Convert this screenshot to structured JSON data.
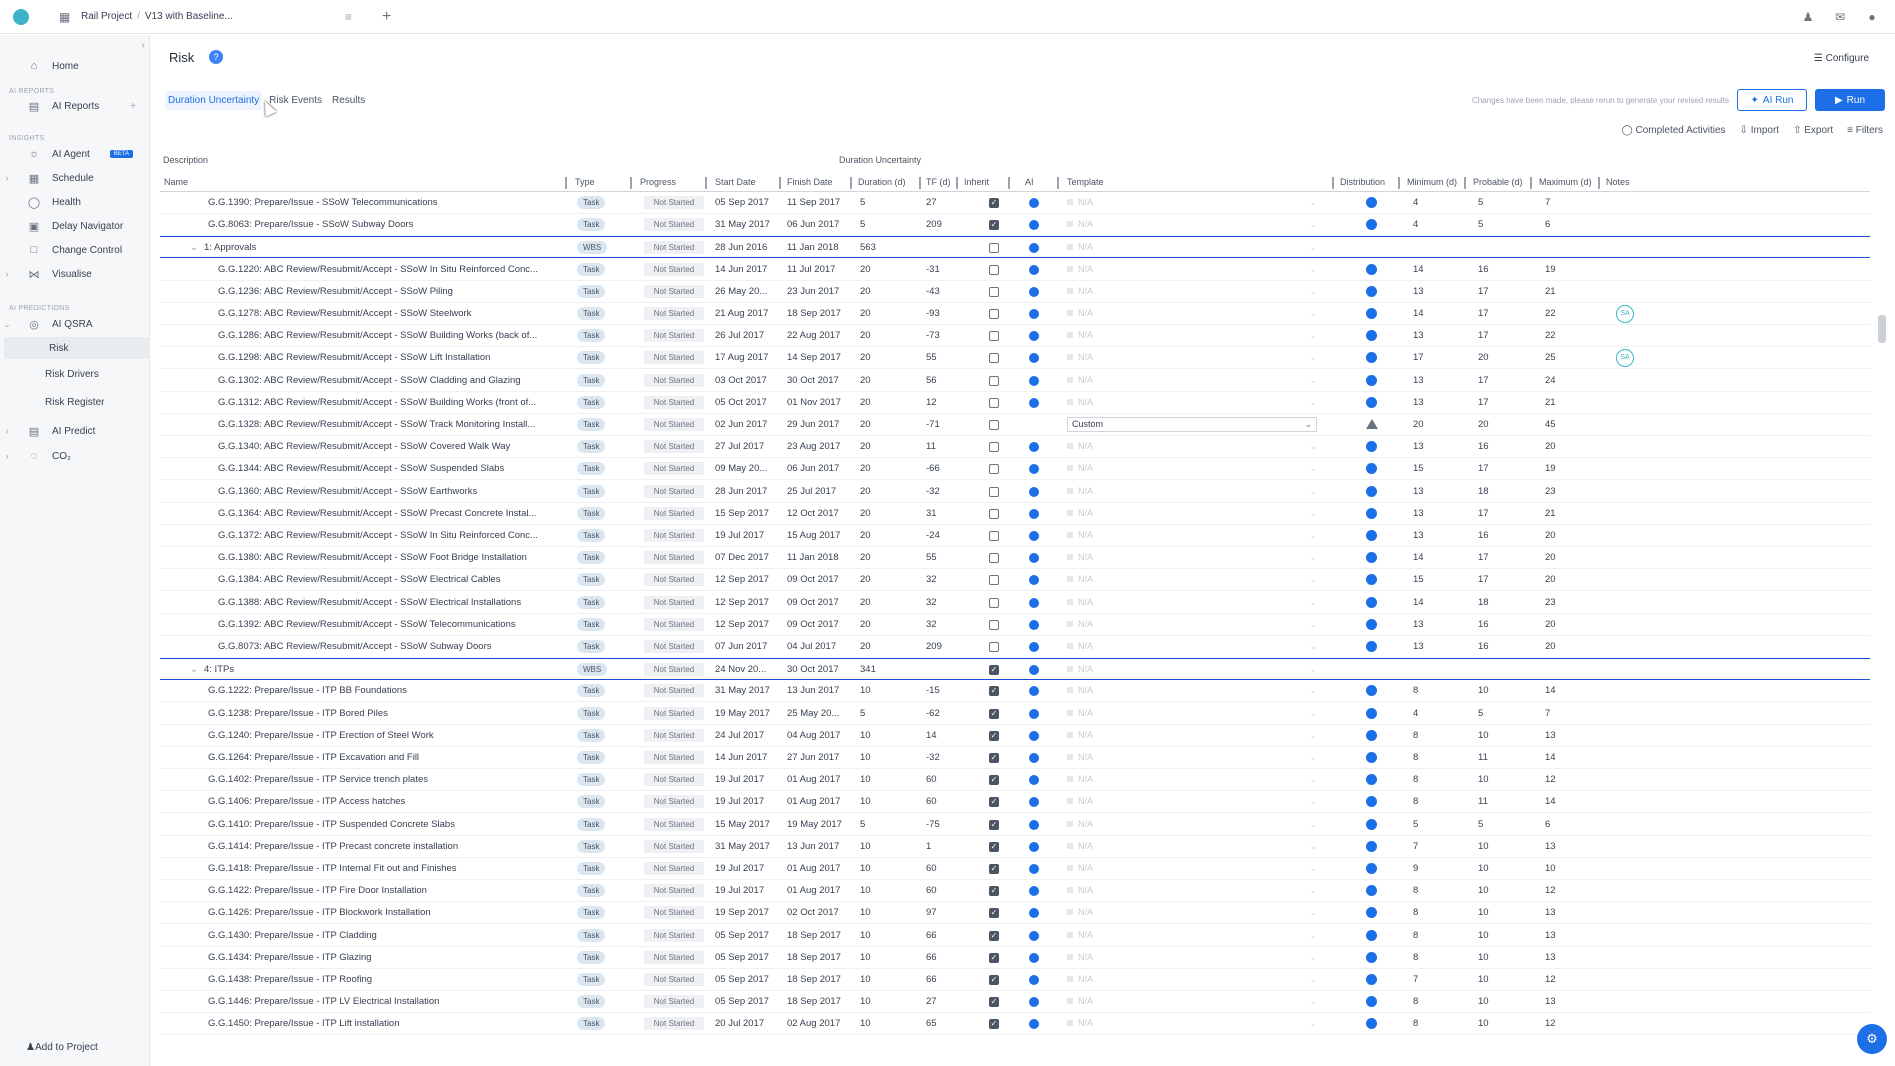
{
  "topbar": {
    "project": "Rail Project",
    "separator": "/",
    "version": "V13 with Baseline..."
  },
  "sidebar": {
    "home": "Home",
    "section_ai_reports": "AI REPORTS",
    "ai_reports": "AI Reports",
    "section_insights": "INSIGHTS",
    "ai_agent": "AI Agent",
    "beta": "BETA",
    "schedule": "Schedule",
    "health": "Health",
    "delay_navigator": "Delay Navigator",
    "change_control": "Change Control",
    "visualise": "Visualise",
    "section_ai_predictions": "AI PREDICTIONS",
    "ai_qsra": "AI QSRA",
    "risk": "Risk",
    "risk_drivers": "Risk Drivers",
    "risk_register": "Risk Register",
    "ai_predict": "AI Predict",
    "co2": "CO₂",
    "add_to_project": "Add to Project"
  },
  "page": {
    "title": "Risk",
    "help": "?",
    "configure": "Configure",
    "tabs": [
      "Duration Uncertainty",
      "Risk Events",
      "Results"
    ],
    "changes_note": "Changes have been made, please rerun to generate your revised results",
    "ai_run": "AI Run",
    "run": "Run",
    "completed_activities": "Completed Activities",
    "import": "Import",
    "export": "Export",
    "filters": "Filters"
  },
  "table": {
    "group_headers": {
      "description": "Description",
      "duration_uncertainty": "Duration Uncertainty"
    },
    "columns": {
      "name": "Name",
      "type": "Type",
      "progress": "Progress",
      "start": "Start Date",
      "finish": "Finish Date",
      "duration": "Duration (d)",
      "tf": "TF (d)",
      "inherit": "Inherit",
      "ai": "AI",
      "template": "Template",
      "distribution": "Distribution",
      "min": "Minimum (d)",
      "probable": "Probable (d)",
      "max": "Maximum (d)",
      "notes": "Notes"
    },
    "rows": [
      {
        "name": "G.G.1390: Prepare/Issue - SSoW Telecommunications",
        "indent": 1,
        "type": "Task",
        "progress": "Not Started",
        "start": "05 Sep 2017",
        "finish": "11 Sep 2017",
        "duration": "5",
        "tf": "27",
        "inherit": true,
        "template": "N/A",
        "dist": "circle",
        "min": "4",
        "prob": "5",
        "max": "7",
        "note": ""
      },
      {
        "name": "G.G.8063: Prepare/Issue - SSoW Subway Doors",
        "indent": 1,
        "type": "Task",
        "progress": "Not Started",
        "start": "31 May 2017",
        "finish": "06 Jun 2017",
        "duration": "5",
        "tf": "209",
        "inherit": true,
        "template": "N/A",
        "dist": "circle",
        "min": "4",
        "prob": "5",
        "max": "6",
        "note": ""
      },
      {
        "name": "1: Approvals",
        "indent": 0,
        "group": true,
        "type": "WBS",
        "progress": "Not Started",
        "start": "28 Jun 2016",
        "finish": "11 Jan 2018",
        "duration": "563",
        "tf": "",
        "inherit": false,
        "template": "N/A",
        "dist": "",
        "min": "",
        "prob": "",
        "max": "",
        "note": ""
      },
      {
        "name": "G.G.1220: ABC Review/Resubmit/Accept - SSoW In Situ Reinforced Conc...",
        "indent": 2,
        "type": "Task",
        "progress": "Not Started",
        "start": "14 Jun 2017",
        "finish": "11 Jul 2017",
        "duration": "20",
        "tf": "-31",
        "inherit": false,
        "template": "N/A",
        "dist": "circle",
        "min": "14",
        "prob": "16",
        "max": "19",
        "note": ""
      },
      {
        "name": "G.G.1236: ABC Review/Resubmit/Accept - SSoW Piling",
        "indent": 2,
        "type": "Task",
        "progress": "Not Started",
        "start": "26 May 20...",
        "finish": "23 Jun 2017",
        "duration": "20",
        "tf": "-43",
        "inherit": false,
        "template": "N/A",
        "dist": "circle",
        "min": "13",
        "prob": "17",
        "max": "21",
        "note": ""
      },
      {
        "name": "G.G.1278: ABC Review/Resubmit/Accept - SSoW Steelwork",
        "indent": 2,
        "type": "Task",
        "progress": "Not Started",
        "start": "21 Aug 2017",
        "finish": "18 Sep 2017",
        "duration": "20",
        "tf": "-93",
        "inherit": false,
        "template": "N/A",
        "dist": "circle",
        "min": "14",
        "prob": "17",
        "max": "22",
        "note": "SA"
      },
      {
        "name": "G.G.1286: ABC Review/Resubmit/Accept - SSoW Building Works (back of...",
        "indent": 2,
        "type": "Task",
        "progress": "Not Started",
        "start": "26 Jul 2017",
        "finish": "22 Aug 2017",
        "duration": "20",
        "tf": "-73",
        "inherit": false,
        "template": "N/A",
        "dist": "circle",
        "min": "13",
        "prob": "17",
        "max": "22",
        "note": ""
      },
      {
        "name": "G.G.1298: ABC Review/Resubmit/Accept - SSoW Lift Installation",
        "indent": 2,
        "type": "Task",
        "progress": "Not Started",
        "start": "17 Aug 2017",
        "finish": "14 Sep 2017",
        "duration": "20",
        "tf": "55",
        "inherit": false,
        "template": "N/A",
        "dist": "circle",
        "min": "17",
        "prob": "20",
        "max": "25",
        "note": "SA"
      },
      {
        "name": "G.G.1302: ABC Review/Resubmit/Accept - SSoW Cladding and Glazing",
        "indent": 2,
        "type": "Task",
        "progress": "Not Started",
        "start": "03 Oct 2017",
        "finish": "30 Oct 2017",
        "duration": "20",
        "tf": "56",
        "inherit": false,
        "template": "N/A",
        "dist": "circle",
        "min": "13",
        "prob": "17",
        "max": "24",
        "note": ""
      },
      {
        "name": "G.G.1312: ABC Review/Resubmit/Accept - SSoW Building Works (front of...",
        "indent": 2,
        "type": "Task",
        "progress": "Not Started",
        "start": "05 Oct 2017",
        "finish": "01 Nov 2017",
        "duration": "20",
        "tf": "12",
        "inherit": false,
        "template": "N/A",
        "dist": "circle",
        "min": "13",
        "prob": "17",
        "max": "21",
        "note": ""
      },
      {
        "name": "G.G.1328: ABC Review/Resubmit/Accept - SSoW Track Monitoring Install...",
        "indent": 2,
        "type": "Task",
        "progress": "Not Started",
        "start": "02 Jun 2017",
        "finish": "29 Jun 2017",
        "duration": "20",
        "tf": "-71",
        "inherit": false,
        "template": "Custom",
        "dist": "triangle",
        "min": "20",
        "prob": "20",
        "max": "45",
        "note": "",
        "no_ai": true
      },
      {
        "name": "G.G.1340: ABC Review/Resubmit/Accept - SSoW Covered Walk Way",
        "indent": 2,
        "type": "Task",
        "progress": "Not Started",
        "start": "27 Jul 2017",
        "finish": "23 Aug 2017",
        "duration": "20",
        "tf": "11",
        "inherit": false,
        "template": "N/A",
        "dist": "circle",
        "min": "13",
        "prob": "16",
        "max": "20",
        "note": ""
      },
      {
        "name": "G.G.1344: ABC Review/Resubmit/Accept - SSoW Suspended Slabs",
        "indent": 2,
        "type": "Task",
        "progress": "Not Started",
        "start": "09 May 20...",
        "finish": "06 Jun 2017",
        "duration": "20",
        "tf": "-66",
        "inherit": false,
        "template": "N/A",
        "dist": "circle",
        "min": "15",
        "prob": "17",
        "max": "19",
        "note": ""
      },
      {
        "name": "G.G.1360: ABC Review/Resubmit/Accept - SSoW Earthworks",
        "indent": 2,
        "type": "Task",
        "progress": "Not Started",
        "start": "28 Jun 2017",
        "finish": "25 Jul 2017",
        "duration": "20",
        "tf": "-32",
        "inherit": false,
        "template": "N/A",
        "dist": "circle",
        "min": "13",
        "prob": "18",
        "max": "23",
        "note": ""
      },
      {
        "name": "G.G.1364: ABC Review/Resubmit/Accept - SSoW Precast Concrete Instal...",
        "indent": 2,
        "type": "Task",
        "progress": "Not Started",
        "start": "15 Sep 2017",
        "finish": "12 Oct 2017",
        "duration": "20",
        "tf": "31",
        "inherit": false,
        "template": "N/A",
        "dist": "circle",
        "min": "13",
        "prob": "17",
        "max": "21",
        "note": ""
      },
      {
        "name": "G.G.1372: ABC Review/Resubmit/Accept - SSoW In Situ Reinforced Conc...",
        "indent": 2,
        "type": "Task",
        "progress": "Not Started",
        "start": "19 Jul 2017",
        "finish": "15 Aug 2017",
        "duration": "20",
        "tf": "-24",
        "inherit": false,
        "template": "N/A",
        "dist": "circle",
        "min": "13",
        "prob": "16",
        "max": "20",
        "note": ""
      },
      {
        "name": "G.G.1380: ABC Review/Resubmit/Accept - SSoW Foot Bridge Installation",
        "indent": 2,
        "type": "Task",
        "progress": "Not Started",
        "start": "07 Dec 2017",
        "finish": "11 Jan 2018",
        "duration": "20",
        "tf": "55",
        "inherit": false,
        "template": "N/A",
        "dist": "circle",
        "min": "14",
        "prob": "17",
        "max": "20",
        "note": ""
      },
      {
        "name": "G.G.1384: ABC Review/Resubmit/Accept - SSoW Electrical Cables",
        "indent": 2,
        "type": "Task",
        "progress": "Not Started",
        "start": "12 Sep 2017",
        "finish": "09 Oct 2017",
        "duration": "20",
        "tf": "32",
        "inherit": false,
        "template": "N/A",
        "dist": "circle",
        "min": "15",
        "prob": "17",
        "max": "20",
        "note": ""
      },
      {
        "name": "G.G.1388: ABC Review/Resubmit/Accept - SSoW Electrical Installations",
        "indent": 2,
        "type": "Task",
        "progress": "Not Started",
        "start": "12 Sep 2017",
        "finish": "09 Oct 2017",
        "duration": "20",
        "tf": "32",
        "inherit": false,
        "template": "N/A",
        "dist": "circle",
        "min": "14",
        "prob": "18",
        "max": "23",
        "note": ""
      },
      {
        "name": "G.G.1392: ABC Review/Resubmit/Accept - SSoW Telecommunications",
        "indent": 2,
        "type": "Task",
        "progress": "Not Started",
        "start": "12 Sep 2017",
        "finish": "09 Oct 2017",
        "duration": "20",
        "tf": "32",
        "inherit": false,
        "template": "N/A",
        "dist": "circle",
        "min": "13",
        "prob": "16",
        "max": "20",
        "note": ""
      },
      {
        "name": "G.G.8073: ABC Review/Resubmit/Accept - SSoW Subway Doors",
        "indent": 2,
        "type": "Task",
        "progress": "Not Started",
        "start": "07 Jun 2017",
        "finish": "04 Jul 2017",
        "duration": "20",
        "tf": "209",
        "inherit": false,
        "template": "N/A",
        "dist": "circle",
        "min": "13",
        "prob": "16",
        "max": "20",
        "note": ""
      },
      {
        "name": "4: ITPs",
        "indent": 0,
        "group": true,
        "type": "WBS",
        "progress": "Not Started",
        "start": "24 Nov 20...",
        "finish": "30 Oct 2017",
        "duration": "341",
        "tf": "",
        "inherit": true,
        "template": "N/A",
        "dist": "",
        "min": "",
        "prob": "",
        "max": "",
        "note": ""
      },
      {
        "name": "G.G.1222: Prepare/Issue - ITP BB Foundations",
        "indent": 1,
        "type": "Task",
        "progress": "Not Started",
        "start": "31 May 2017",
        "finish": "13 Jun 2017",
        "duration": "10",
        "tf": "-15",
        "inherit": true,
        "template": "N/A",
        "dist": "circle",
        "min": "8",
        "prob": "10",
        "max": "14",
        "note": ""
      },
      {
        "name": "G.G.1238: Prepare/Issue - ITP Bored Piles",
        "indent": 1,
        "type": "Task",
        "progress": "Not Started",
        "start": "19 May 2017",
        "finish": "25 May 20...",
        "duration": "5",
        "tf": "-62",
        "inherit": true,
        "template": "N/A",
        "dist": "circle",
        "min": "4",
        "prob": "5",
        "max": "7",
        "note": ""
      },
      {
        "name": "G.G.1240: Prepare/Issue - ITP Erection of Steel Work",
        "indent": 1,
        "type": "Task",
        "progress": "Not Started",
        "start": "24 Jul 2017",
        "finish": "04 Aug 2017",
        "duration": "10",
        "tf": "14",
        "inherit": true,
        "template": "N/A",
        "dist": "circle",
        "min": "8",
        "prob": "10",
        "max": "13",
        "note": ""
      },
      {
        "name": "G.G.1264: Prepare/Issue - ITP Excavation and Fill",
        "indent": 1,
        "type": "Task",
        "progress": "Not Started",
        "start": "14 Jun 2017",
        "finish": "27 Jun 2017",
        "duration": "10",
        "tf": "-32",
        "inherit": true,
        "template": "N/A",
        "dist": "circle",
        "min": "8",
        "prob": "11",
        "max": "14",
        "note": ""
      },
      {
        "name": "G.G.1402: Prepare/Issue - ITP Service trench plates",
        "indent": 1,
        "type": "Task",
        "progress": "Not Started",
        "start": "19 Jul 2017",
        "finish": "01 Aug 2017",
        "duration": "10",
        "tf": "60",
        "inherit": true,
        "template": "N/A",
        "dist": "circle",
        "min": "8",
        "prob": "10",
        "max": "12",
        "note": ""
      },
      {
        "name": "G.G.1406: Prepare/Issue - ITP Access hatches",
        "indent": 1,
        "type": "Task",
        "progress": "Not Started",
        "start": "19 Jul 2017",
        "finish": "01 Aug 2017",
        "duration": "10",
        "tf": "60",
        "inherit": true,
        "template": "N/A",
        "dist": "circle",
        "min": "8",
        "prob": "11",
        "max": "14",
        "note": ""
      },
      {
        "name": "G.G.1410: Prepare/Issue - ITP Suspended Concrete Slabs",
        "indent": 1,
        "type": "Task",
        "progress": "Not Started",
        "start": "15 May 2017",
        "finish": "19 May 2017",
        "duration": "5",
        "tf": "-75",
        "inherit": true,
        "template": "N/A",
        "dist": "circle",
        "min": "5",
        "prob": "5",
        "max": "6",
        "note": ""
      },
      {
        "name": "G.G.1414: Prepare/Issue - ITP Precast concrete installation",
        "indent": 1,
        "type": "Task",
        "progress": "Not Started",
        "start": "31 May 2017",
        "finish": "13 Jun 2017",
        "duration": "10",
        "tf": "1",
        "inherit": true,
        "template": "N/A",
        "dist": "circle",
        "min": "7",
        "prob": "10",
        "max": "13",
        "note": ""
      },
      {
        "name": "G.G.1418: Prepare/Issue - ITP Internal Fit out and Finishes",
        "indent": 1,
        "type": "Task",
        "progress": "Not Started",
        "start": "19 Jul 2017",
        "finish": "01 Aug 2017",
        "duration": "10",
        "tf": "60",
        "inherit": true,
        "template": "N/A",
        "dist": "circle",
        "min": "9",
        "prob": "10",
        "max": "10",
        "note": ""
      },
      {
        "name": "G.G.1422: Prepare/Issue - ITP Fire Door Installation",
        "indent": 1,
        "type": "Task",
        "progress": "Not Started",
        "start": "19 Jul 2017",
        "finish": "01 Aug 2017",
        "duration": "10",
        "tf": "60",
        "inherit": true,
        "template": "N/A",
        "dist": "circle",
        "min": "8",
        "prob": "10",
        "max": "12",
        "note": ""
      },
      {
        "name": "G.G.1426: Prepare/Issue - ITP Blockwork Installation",
        "indent": 1,
        "type": "Task",
        "progress": "Not Started",
        "start": "19 Sep 2017",
        "finish": "02 Oct 2017",
        "duration": "10",
        "tf": "97",
        "inherit": true,
        "template": "N/A",
        "dist": "circle",
        "min": "8",
        "prob": "10",
        "max": "13",
        "note": ""
      },
      {
        "name": "G.G.1430: Prepare/Issue - ITP Cladding",
        "indent": 1,
        "type": "Task",
        "progress": "Not Started",
        "start": "05 Sep 2017",
        "finish": "18 Sep 2017",
        "duration": "10",
        "tf": "66",
        "inherit": true,
        "template": "N/A",
        "dist": "circle",
        "min": "8",
        "prob": "10",
        "max": "13",
        "note": ""
      },
      {
        "name": "G.G.1434: Prepare/Issue - ITP Glazing",
        "indent": 1,
        "type": "Task",
        "progress": "Not Started",
        "start": "05 Sep 2017",
        "finish": "18 Sep 2017",
        "duration": "10",
        "tf": "66",
        "inherit": true,
        "template": "N/A",
        "dist": "circle",
        "min": "8",
        "prob": "10",
        "max": "13",
        "note": ""
      },
      {
        "name": "G.G.1438: Prepare/Issue - ITP Roofing",
        "indent": 1,
        "type": "Task",
        "progress": "Not Started",
        "start": "05 Sep 2017",
        "finish": "18 Sep 2017",
        "duration": "10",
        "tf": "66",
        "inherit": true,
        "template": "N/A",
        "dist": "circle",
        "min": "7",
        "prob": "10",
        "max": "12",
        "note": ""
      },
      {
        "name": "G.G.1446: Prepare/Issue - ITP LV Electrical Installation",
        "indent": 1,
        "type": "Task",
        "progress": "Not Started",
        "start": "05 Sep 2017",
        "finish": "18 Sep 2017",
        "duration": "10",
        "tf": "27",
        "inherit": true,
        "template": "N/A",
        "dist": "circle",
        "min": "8",
        "prob": "10",
        "max": "13",
        "note": ""
      },
      {
        "name": "G.G.1450: Prepare/Issue - ITP Lift installation",
        "indent": 1,
        "type": "Task",
        "progress": "Not Started",
        "start": "20 Jul 2017",
        "finish": "02 Aug 2017",
        "duration": "10",
        "tf": "65",
        "inherit": true,
        "template": "N/A",
        "dist": "circle",
        "min": "8",
        "prob": "10",
        "max": "12",
        "note": ""
      }
    ]
  }
}
